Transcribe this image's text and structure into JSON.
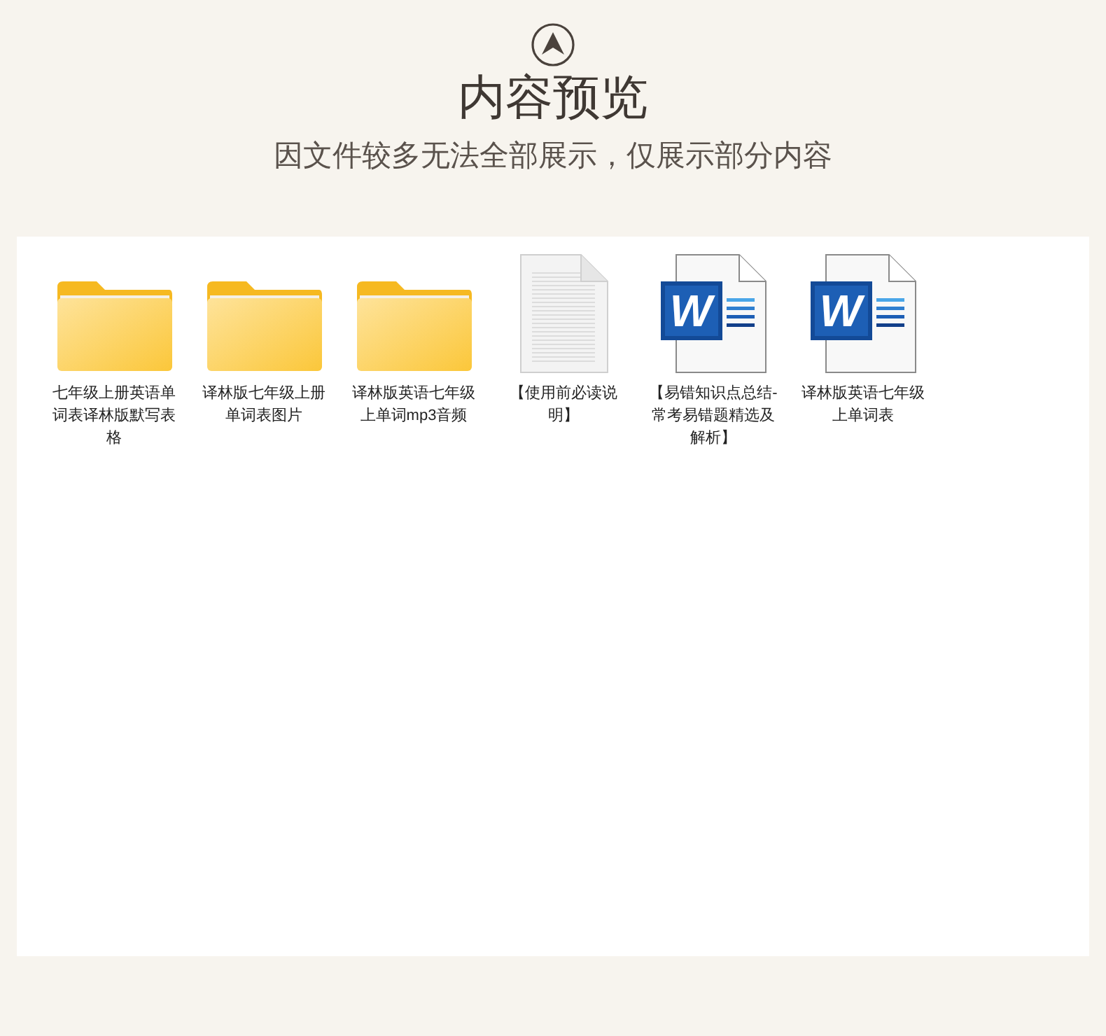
{
  "header": {
    "title": "内容预览",
    "subtitle": "因文件较多无法全部展示，仅展示部分内容"
  },
  "files": [
    {
      "kind": "folder",
      "name": "七年级上册英语单词表译林版默写表格"
    },
    {
      "kind": "folder",
      "name": "译林版七年级上册单词表图片"
    },
    {
      "kind": "folder",
      "name": "译林版英语七年级上单词mp3音频"
    },
    {
      "kind": "text",
      "name": "【使用前必读说明】"
    },
    {
      "kind": "word",
      "name": "【易错知识点总结-常考易错题精选及解析】",
      "icon_letter": "W"
    },
    {
      "kind": "word",
      "name": "译林版英语七年级上单词表",
      "icon_letter": "W"
    }
  ]
}
